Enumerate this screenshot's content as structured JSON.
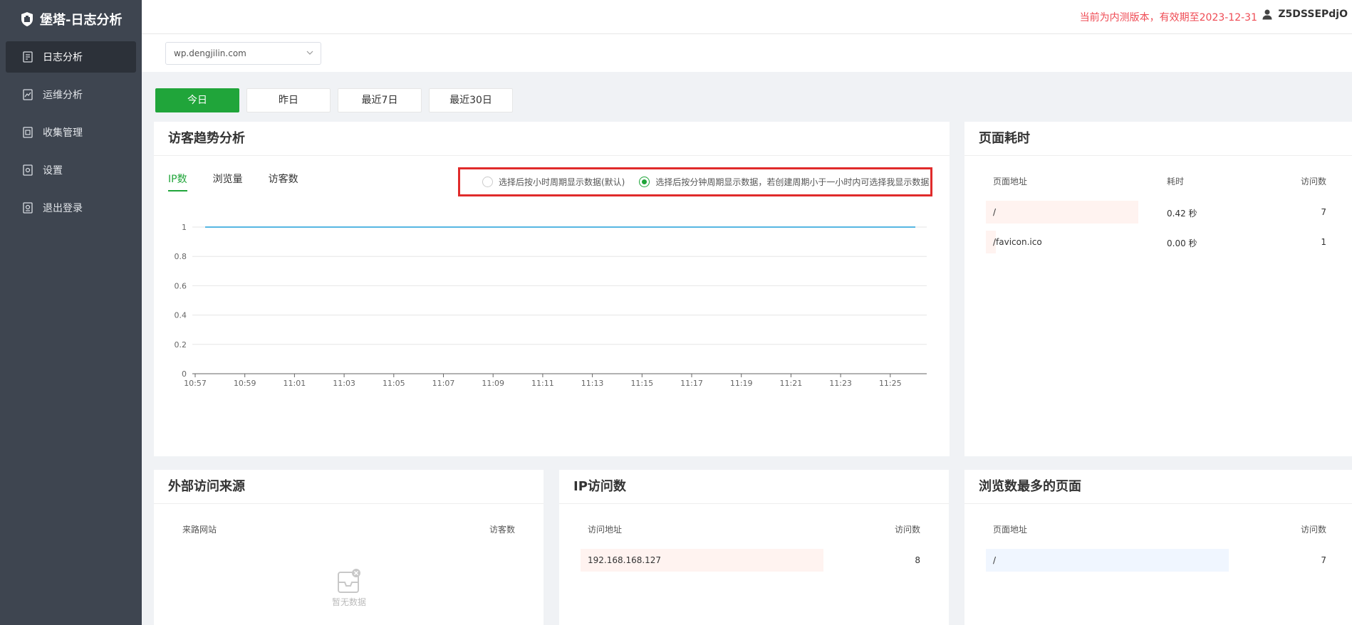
{
  "brand": {
    "title": "堡塔-日志分析"
  },
  "sidebar": {
    "items": [
      {
        "label": "日志分析",
        "active": true,
        "icon": "log-icon"
      },
      {
        "label": "运维分析",
        "active": false,
        "icon": "chart-icon"
      },
      {
        "label": "收集管理",
        "active": false,
        "icon": "collect-icon"
      },
      {
        "label": "设置",
        "active": false,
        "icon": "settings-icon"
      },
      {
        "label": "退出登录",
        "active": false,
        "icon": "logout-icon"
      }
    ]
  },
  "header": {
    "notice": "当前为内测版本，有效期至2023-12-31",
    "username": "Z5DSSEPdjO"
  },
  "site_select": {
    "value": "wp.dengjilin.com"
  },
  "date_buttons": [
    "今日",
    "昨日",
    "最近7日",
    "最近30日"
  ],
  "trend": {
    "title": "访客趋势分析",
    "tabs": [
      "IP数",
      "浏览量",
      "访客数"
    ],
    "radio_hour": "选择后按小时周期显示数据(默认)",
    "radio_minute": "选择后按分钟周期显示数据，若创建周期小于一小时内可选择我显示数据"
  },
  "chart_data": {
    "type": "line",
    "x": [
      "10:57",
      "10:59",
      "11:01",
      "11:03",
      "11:05",
      "11:07",
      "11:09",
      "11:11",
      "11:13",
      "11:15",
      "11:17",
      "11:19",
      "11:21",
      "11:23",
      "11:25"
    ],
    "series": [
      {
        "values": [
          1,
          1,
          1,
          1,
          1,
          1,
          1,
          1,
          1,
          1,
          1,
          1,
          1,
          1,
          1
        ]
      }
    ],
    "yticks": [
      "0",
      "0.2",
      "0.4",
      "0.6",
      "0.8",
      "1"
    ],
    "ylim": [
      0,
      1
    ],
    "grid": true,
    "color": "#1e9fd8"
  },
  "timing": {
    "title": "页面耗时",
    "headers": [
      "页面地址",
      "耗时",
      "访问数"
    ],
    "rows": [
      {
        "path": "/",
        "time": "0.42 秒",
        "count": "7"
      },
      {
        "path": "/favicon.ico",
        "time": "0.00 秒",
        "count": "1"
      }
    ]
  },
  "referer": {
    "title": "外部访问来源",
    "headers": [
      "来路网站",
      "访客数"
    ],
    "empty_text": "暂无数据"
  },
  "ipvisit": {
    "title": "IP访问数",
    "headers": [
      "访问地址",
      "访问数"
    ],
    "rows": [
      {
        "ip": "192.168.168.127",
        "count": "8"
      }
    ]
  },
  "toppages": {
    "title": "浏览数最多的页面",
    "headers": [
      "页面地址",
      "访问数"
    ],
    "rows": [
      {
        "path": "/",
        "count": "7"
      }
    ]
  }
}
